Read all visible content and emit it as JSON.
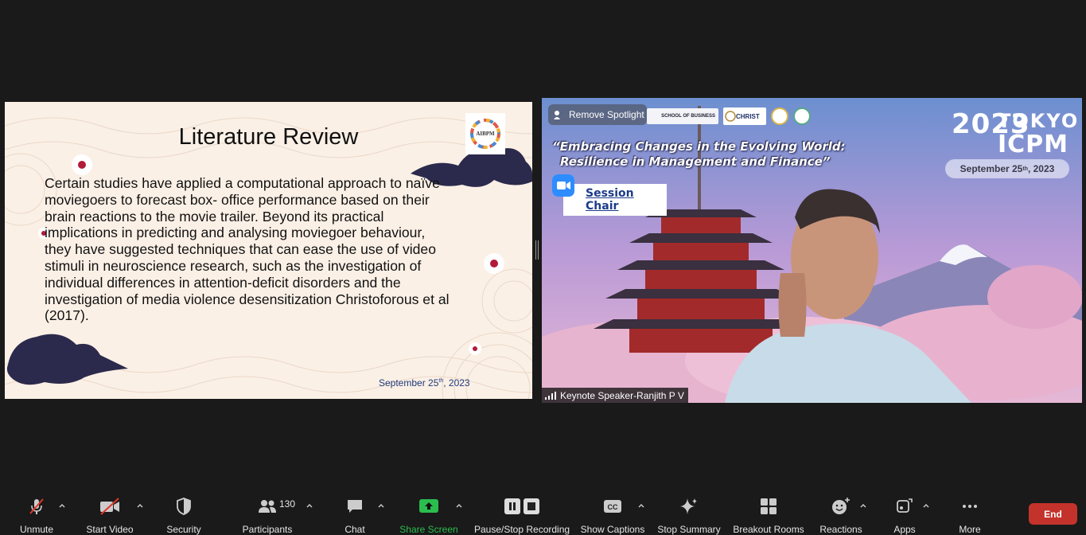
{
  "slide": {
    "title": "Literature Review",
    "logo_text": "AIBPM",
    "body_line1": "Certain studies have applied a computational approach to naïve",
    "body_lines": [
      "moviegoers to forecast box- office performance based on their",
      "brain reactions to the movie trailer. Beyond its practical",
      "implications in predicting and analysing moviegoer behaviour,",
      "they have suggested techniques that can ease the use of video",
      "stimuli in neuroscience research, such as the investigation of",
      "individual differences in attention-deficit disorders and the",
      "investigation of media violence desensitization Christoforous et al",
      "(2017)."
    ],
    "date_prefix": "September 25",
    "date_sup": "th",
    "date_suffix": ", 2023"
  },
  "video": {
    "remove_spotlight": "Remove Spotlight",
    "logo_school": "SCHOOL OF BUSINESS",
    "logo_christ": "CHRIST",
    "quote_line1": "“Embracing Changes in the Evolving World:",
    "quote_line2": "Resilience in Management and Finance”",
    "session_chair": "Session Chair",
    "event_year": "2023",
    "event_city": "TOKYO",
    "event_name": "ICPM",
    "event_date_prefix": "September 25",
    "event_date_sup": "th",
    "event_date_suffix": ", 2023",
    "participant_name": "Keynote Speaker-Ranjith P V"
  },
  "toolbar": {
    "unmute": "Unmute",
    "start_video": "Start Video",
    "security": "Security",
    "participants": "Participants",
    "participants_count": "130",
    "chat": "Chat",
    "share_screen": "Share Screen",
    "pause_stop_recording": "Pause/Stop Recording",
    "show_captions": "Show Captions",
    "stop_summary": "Stop Summary",
    "breakout_rooms": "Breakout Rooms",
    "reactions": "Reactions",
    "apps": "Apps",
    "more": "More",
    "end": "End"
  },
  "colors": {
    "share_screen_green": "#2bbd4e",
    "end_red": "#c4332b",
    "slide_bg": "#fbf0e6",
    "accent_navy": "#2b2a4c"
  }
}
